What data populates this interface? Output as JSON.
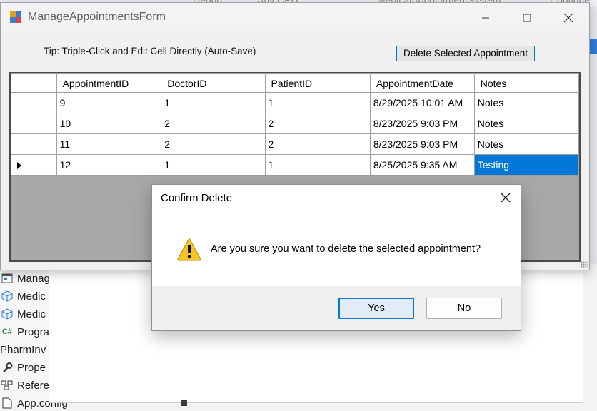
{
  "ide": {
    "tabs": [
      "Debug",
      "Any CPU",
      "MedicalAppointmentSystem",
      "Continue"
    ],
    "solution_items": [
      {
        "label": "Manag",
        "icon": "form-icon"
      },
      {
        "label": "Medic",
        "icon": "cube-icon"
      },
      {
        "label": "Medic",
        "icon": "cube-icon"
      },
      {
        "label": "Progra",
        "icon": "csharp-file-icon",
        "icon_text": "C#"
      },
      {
        "label": "PharmInv",
        "icon": ""
      },
      {
        "label": "Prope",
        "icon": "wrench-icon"
      },
      {
        "label": "Refere",
        "icon": "references-icon"
      },
      {
        "label": "App.config",
        "icon": "config-file-icon"
      }
    ]
  },
  "form": {
    "title": "ManageAppointmentsForm",
    "tip": "Tip: Triple-Click and Edit Cell Directly (Auto-Save)",
    "delete_button": "Delete Selected Appointment",
    "grid": {
      "columns": [
        "AppointmentID",
        "DoctorID",
        "PatientID",
        "AppointmentDate",
        "Notes"
      ],
      "rows": [
        {
          "AppointmentID": "9",
          "DoctorID": "1",
          "PatientID": "1",
          "AppointmentDate": "8/29/2025 10:01 AM",
          "Notes": "Notes"
        },
        {
          "AppointmentID": "10",
          "DoctorID": "2",
          "PatientID": "2",
          "AppointmentDate": "8/23/2025 9:03 PM",
          "Notes": "Notes"
        },
        {
          "AppointmentID": "11",
          "DoctorID": "2",
          "PatientID": "2",
          "AppointmentDate": "8/23/2025 9:03 PM",
          "Notes": "Notes"
        },
        {
          "AppointmentID": "12",
          "DoctorID": "1",
          "PatientID": "1",
          "AppointmentDate": "8/25/2025 9:35 AM",
          "Notes": "Testing"
        }
      ],
      "current_row_index": 3,
      "selected_cell": {
        "row": 3,
        "column": "Notes"
      }
    }
  },
  "dialog": {
    "title": "Confirm Delete",
    "message": "Are you sure you want to delete the selected appointment?",
    "icon": "warning-icon",
    "yes_label": "Yes",
    "no_label": "No"
  },
  "colors": {
    "selection": "#0078d7",
    "warning": "#f7c325"
  }
}
